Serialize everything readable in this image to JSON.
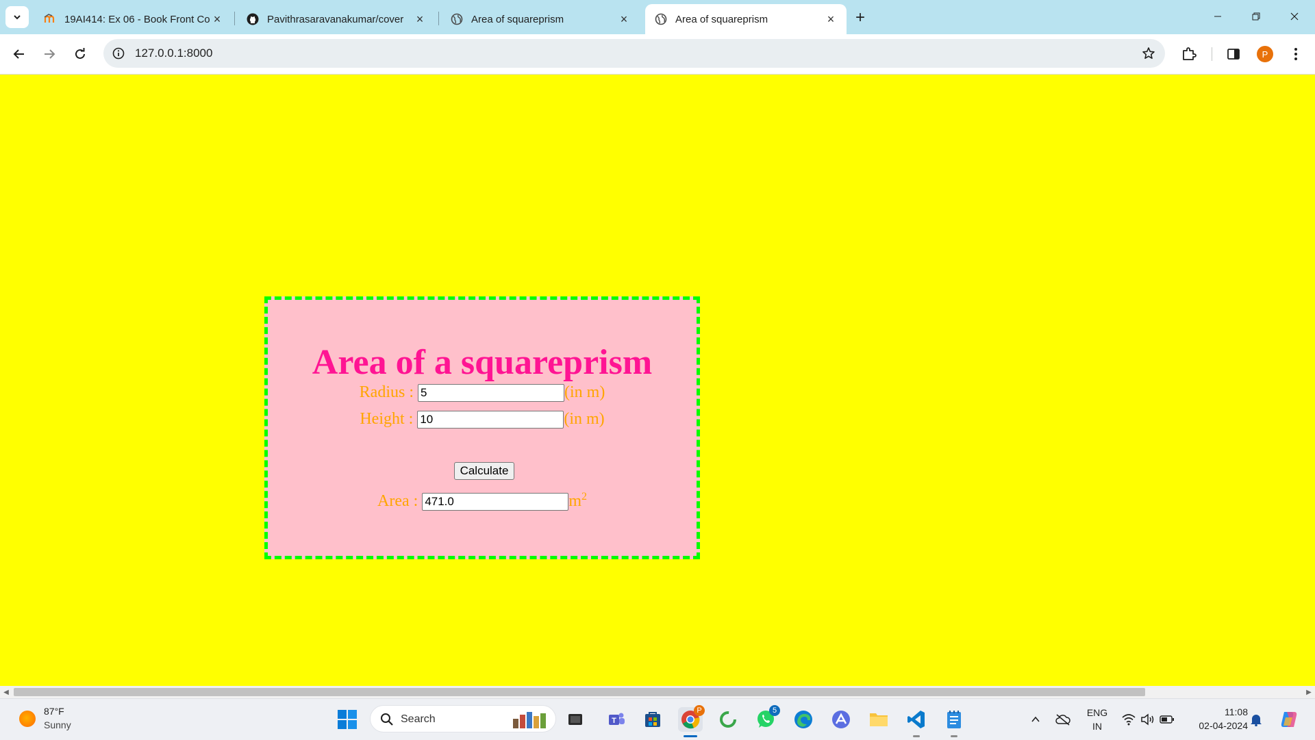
{
  "browser": {
    "tabs": [
      {
        "title": "19AI414: Ex 06 - Book Front Co",
        "icon": "moodle-icon",
        "active": false
      },
      {
        "title": "Pavithrasaravanakumar/cover",
        "icon": "github-icon",
        "active": false
      },
      {
        "title": "Area of squareprism",
        "icon": "globe-icon",
        "active": false
      },
      {
        "title": "Area of squareprism",
        "icon": "globe-icon",
        "active": true
      }
    ],
    "url": "127.0.0.1:8000",
    "profile_initial": "P"
  },
  "page": {
    "background_color": "#ffff00",
    "card": {
      "background_color": "#ffc0cb",
      "border_color": "#00ff00",
      "title": "Area of a squareprism",
      "radius_label": "Radius :",
      "radius_value": "5",
      "radius_unit": "(in m)",
      "height_label": "Height :",
      "height_value": "10",
      "height_unit": "(in m)",
      "calculate_label": "Calculate",
      "area_label": "Area :",
      "area_value": "471.0",
      "area_unit": "m",
      "area_unit_sup": "2"
    }
  },
  "taskbar": {
    "weather_temp": "87°F",
    "weather_desc": "Sunny",
    "search_placeholder": "Search",
    "whatsapp_badge": "5",
    "chrome_badge": "P",
    "language": "ENG",
    "region": "IN",
    "time": "11:08",
    "date": "02-04-2024"
  }
}
